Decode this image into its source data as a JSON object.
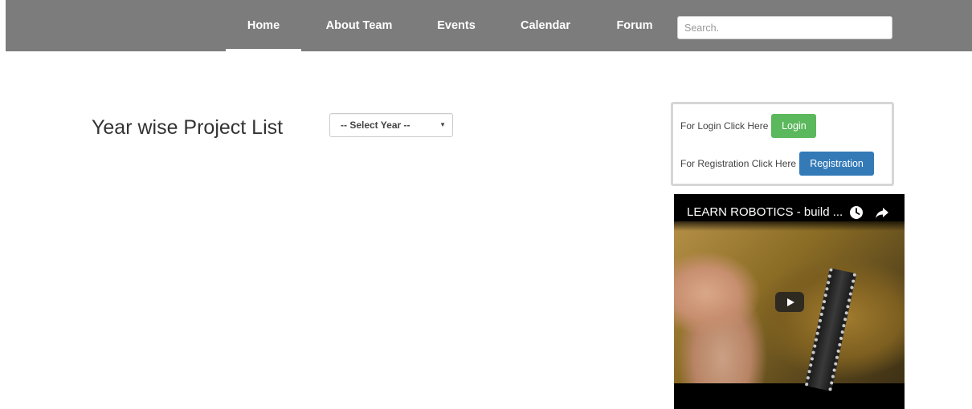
{
  "nav": {
    "items": [
      {
        "label": "Home",
        "active": true
      },
      {
        "label": "About Team",
        "active": false
      },
      {
        "label": "Events",
        "active": false
      },
      {
        "label": "Calendar",
        "active": false
      },
      {
        "label": "Forum",
        "active": false
      }
    ],
    "search_placeholder": "Search.",
    "background_color": "#7c7c7c"
  },
  "main": {
    "title": "Year wise Project List",
    "year_select": {
      "selected": "-- Select Year --"
    }
  },
  "sidebar": {
    "login_text": "For Login Click Here",
    "login_button": "Login",
    "registration_text": "For Registration Click Here",
    "registration_button": "Registration",
    "login_color": "#5cb85c",
    "registration_color": "#337ab7"
  },
  "video": {
    "title": "LEARN ROBOTICS - build ...",
    "icons": [
      "clock-icon",
      "share-icon",
      "play-icon"
    ]
  }
}
